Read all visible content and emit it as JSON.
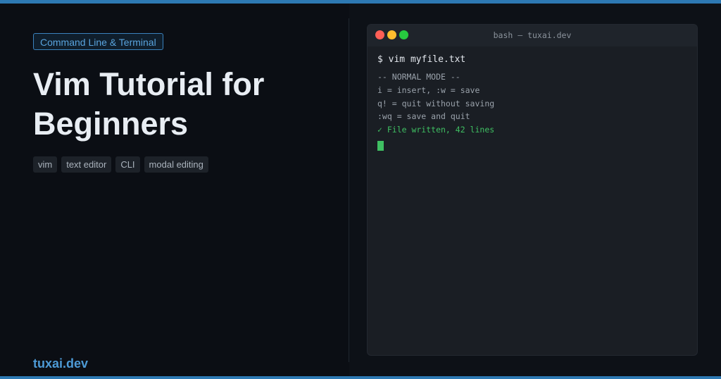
{
  "category": "Command Line & Terminal",
  "title": "Vim Tutorial for Beginners",
  "tags": [
    "vim",
    "text editor",
    "CLI",
    "modal editing"
  ],
  "site": "tuxai.dev",
  "terminal": {
    "window_title": "bash — tuxai.dev",
    "prompt": "$ vim myfile.txt",
    "lines": [
      "-- NORMAL MODE --",
      "i = insert, :w = save",
      "q! = quit without saving",
      ":wq = save and quit"
    ],
    "success_line": "✓ File written, 42 lines"
  },
  "colors": {
    "accent": "#2d79b3",
    "background": "#0b0e14",
    "terminal_bg": "#1a1e24",
    "success": "#3fbf62",
    "close_dot": "#ff5f56",
    "minimize_dot": "#ffbd2e",
    "maximize_dot": "#27c93f"
  }
}
